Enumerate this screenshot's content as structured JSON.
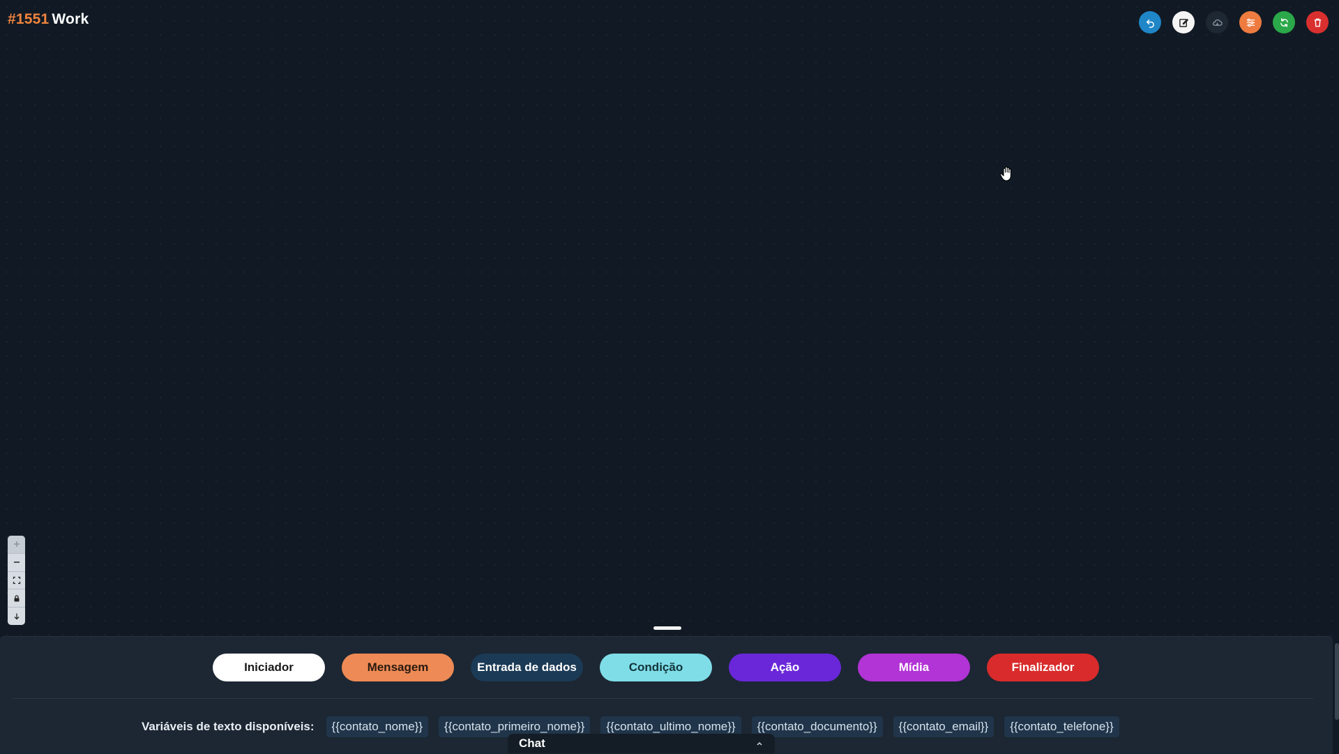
{
  "header": {
    "flow_number": "#1551",
    "flow_name": "Work"
  },
  "toolbar": [
    {
      "name": "undo-button",
      "icon": "undo-icon",
      "color": "#1f86c8"
    },
    {
      "name": "edit-button",
      "icon": "edit-icon",
      "color": "#f4f4f4"
    },
    {
      "name": "cloud-button",
      "icon": "cloud-icon",
      "color": "#1e2833"
    },
    {
      "name": "settings-button",
      "icon": "sliders-icon",
      "color": "#ee7b3f"
    },
    {
      "name": "refresh-button",
      "icon": "refresh-icon",
      "color": "#2ba84a"
    },
    {
      "name": "delete-button",
      "icon": "trash-icon",
      "color": "#d9302f"
    }
  ],
  "zoom_controls": [
    "zoom-in-icon",
    "zoom-out-icon",
    "fit-view-icon",
    "lock-icon",
    "download-icon"
  ],
  "node_types": [
    {
      "label": "Iniciador",
      "bg": "#ffffff",
      "fg": "#1a1a1a"
    },
    {
      "label": "Mensagem",
      "bg": "#ee8a55",
      "fg": "#2a1a10"
    },
    {
      "label": "Entrada de dados",
      "bg": "#1b3a55",
      "fg": "#ffffff"
    },
    {
      "label": "Condição",
      "bg": "#7fdde8",
      "fg": "#12343a"
    },
    {
      "label": "Ação",
      "bg": "#6a27d9",
      "fg": "#ffffff"
    },
    {
      "label": "Mídia",
      "bg": "#b233d6",
      "fg": "#ffffff"
    },
    {
      "label": "Finalizador",
      "bg": "#d92b2b",
      "fg": "#ffffff"
    }
  ],
  "variables": {
    "label": "Variáveis de texto disponíveis:",
    "items": [
      "{{contato_nome}}",
      "{{contato_primeiro_nome}}",
      "{{contato_ultimo_nome}}",
      "{{contato_documento}}",
      "{{contato_email}}",
      "{{contato_telefone}}"
    ]
  },
  "chat": {
    "label": "Chat",
    "icon": "chevron-up-icon"
  }
}
